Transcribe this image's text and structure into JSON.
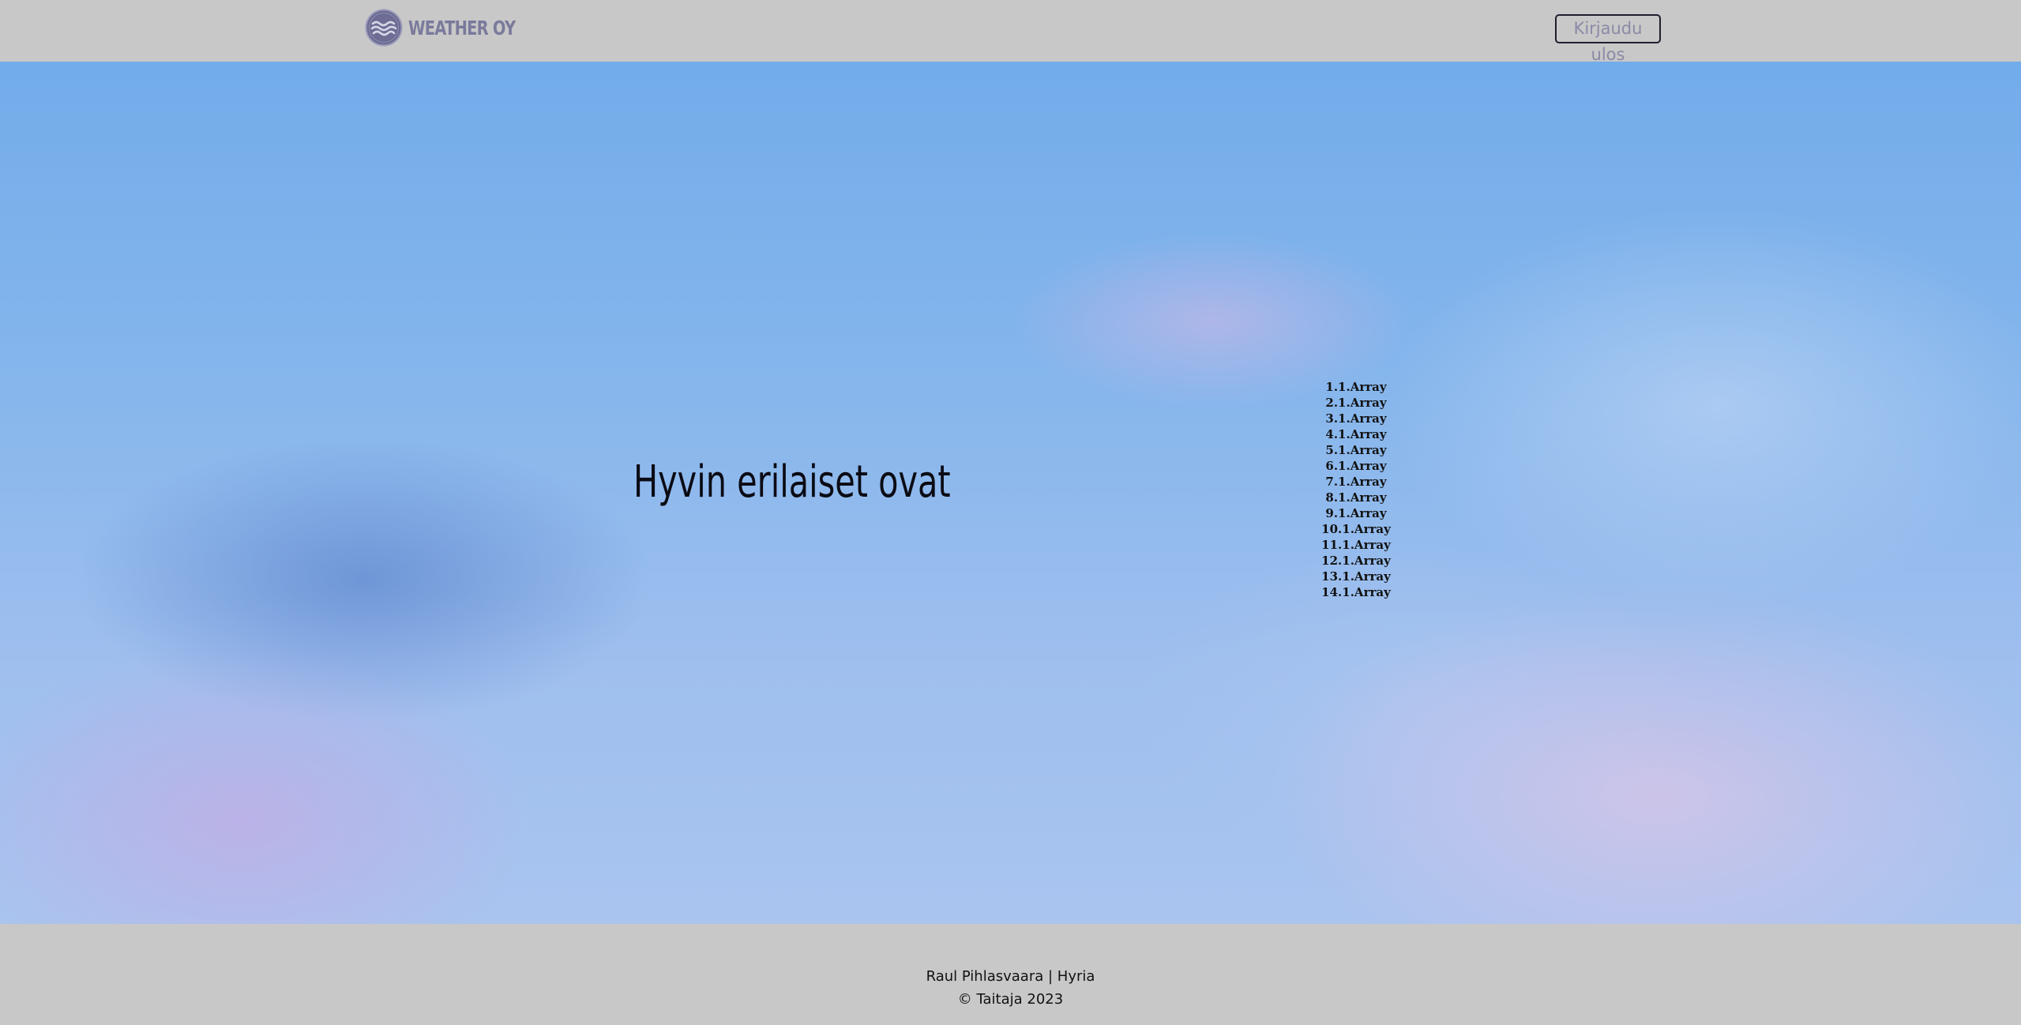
{
  "header": {
    "brand": "WEATHER OY",
    "logo_icon": "waves-logo-icon",
    "logout_label": "Kirjaudu ulos"
  },
  "hero": {
    "title": "Hyvin erilaiset ovat",
    "items": [
      "1.1.Array",
      "2.1.Array",
      "3.1.Array",
      "4.1.Array",
      "5.1.Array",
      "6.1.Array",
      "7.1.Array",
      "8.1.Array",
      "9.1.Array",
      "10.1.Array",
      "11.1.Array",
      "12.1.Array",
      "13.1.Array",
      "14.1.Array"
    ]
  },
  "footer": {
    "author": "Raul Pihlasvaara | Hyria",
    "copyright": "© Taitaja 2023"
  },
  "colors": {
    "bar_background": "#c8c8c8",
    "brand_text": "#7a7a9c",
    "logo": "#6c6c94"
  }
}
